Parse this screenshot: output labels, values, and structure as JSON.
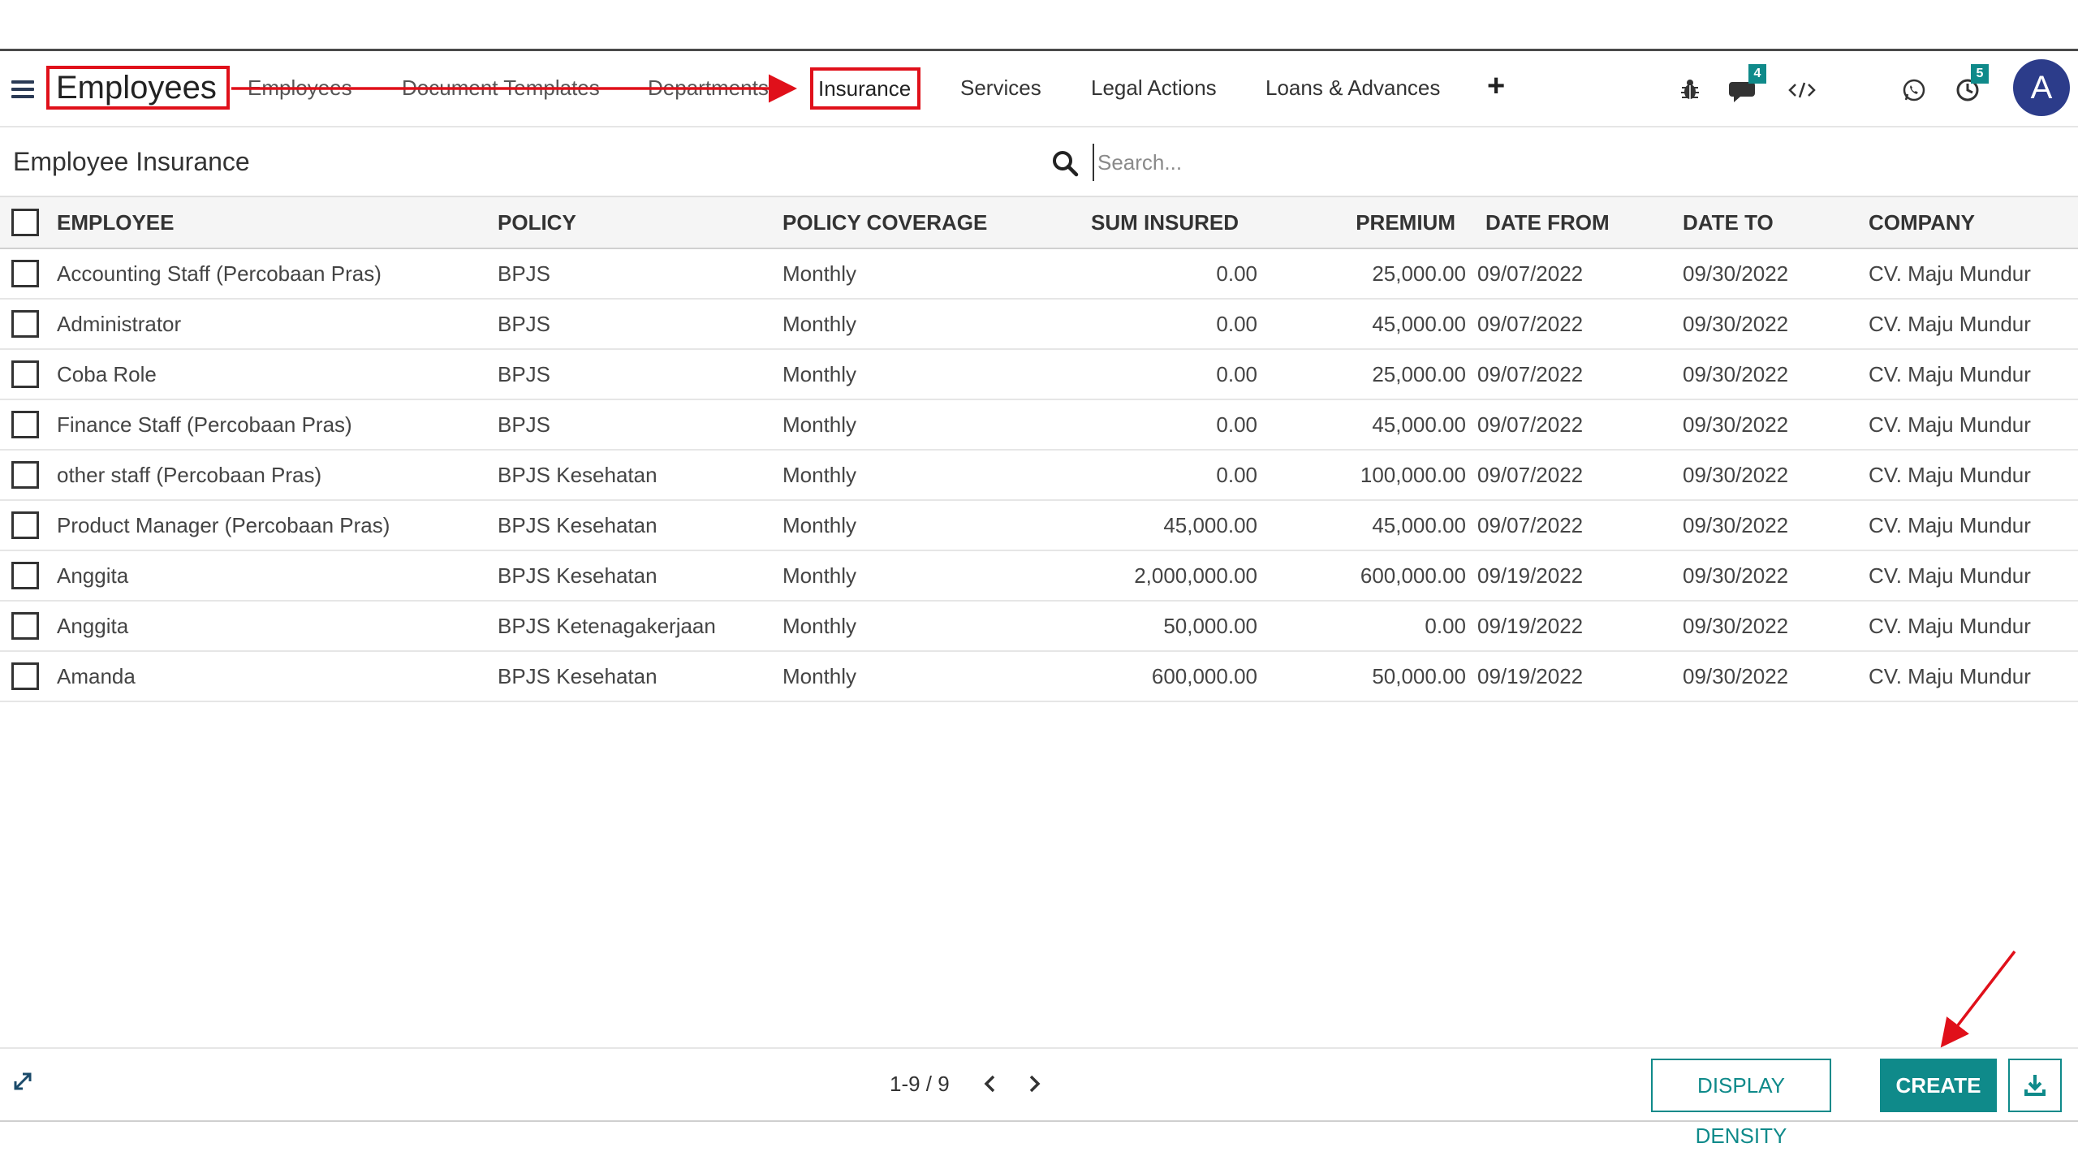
{
  "navbar": {
    "app_title": "Employees",
    "menu": [
      {
        "label": "Employees"
      },
      {
        "label": "Document Templates"
      },
      {
        "label": "Departments"
      },
      {
        "label": "Insurance"
      },
      {
        "label": "Services"
      },
      {
        "label": "Legal Actions"
      },
      {
        "label": "Loans & Advances"
      }
    ],
    "add_label": "+",
    "messages_badge": "4",
    "activities_badge": "5",
    "avatar_letter": "A"
  },
  "controlpanel": {
    "breadcrumb": "Employee Insurance",
    "search_placeholder": "Search..."
  },
  "table": {
    "columns": [
      "EMPLOYEE",
      "POLICY",
      "POLICY COVERAGE",
      "SUM INSURED",
      "PREMIUM",
      "DATE FROM",
      "DATE TO",
      "COMPANY"
    ],
    "rows": [
      {
        "employee": "Accounting Staff (Percobaan Pras)",
        "policy": "BPJS",
        "coverage": "Monthly",
        "sum_insured": "0.00",
        "premium": "25,000.00",
        "date_from": "09/07/2022",
        "date_to": "09/30/2022",
        "company": "CV. Maju Mundur"
      },
      {
        "employee": "Administrator",
        "policy": "BPJS",
        "coverage": "Monthly",
        "sum_insured": "0.00",
        "premium": "45,000.00",
        "date_from": "09/07/2022",
        "date_to": "09/30/2022",
        "company": "CV. Maju Mundur"
      },
      {
        "employee": "Coba Role",
        "policy": "BPJS",
        "coverage": "Monthly",
        "sum_insured": "0.00",
        "premium": "25,000.00",
        "date_from": "09/07/2022",
        "date_to": "09/30/2022",
        "company": "CV. Maju Mundur"
      },
      {
        "employee": "Finance Staff (Percobaan Pras)",
        "policy": "BPJS",
        "coverage": "Monthly",
        "sum_insured": "0.00",
        "premium": "45,000.00",
        "date_from": "09/07/2022",
        "date_to": "09/30/2022",
        "company": "CV. Maju Mundur"
      },
      {
        "employee": "other staff (Percobaan Pras)",
        "policy": "BPJS Kesehatan",
        "coverage": "Monthly",
        "sum_insured": "0.00",
        "premium": "100,000.00",
        "date_from": "09/07/2022",
        "date_to": "09/30/2022",
        "company": "CV. Maju Mundur"
      },
      {
        "employee": "Product Manager (Percobaan Pras)",
        "policy": "BPJS Kesehatan",
        "coverage": "Monthly",
        "sum_insured": "45,000.00",
        "premium": "45,000.00",
        "date_from": "09/07/2022",
        "date_to": "09/30/2022",
        "company": "CV. Maju Mundur"
      },
      {
        "employee": "Anggita",
        "policy": "BPJS Kesehatan",
        "coverage": "Monthly",
        "sum_insured": "2,000,000.00",
        "premium": "600,000.00",
        "date_from": "09/19/2022",
        "date_to": "09/30/2022",
        "company": "CV. Maju Mundur"
      },
      {
        "employee": "Anggita",
        "policy": "BPJS Ketenagakerjaan",
        "coverage": "Monthly",
        "sum_insured": "50,000.00",
        "premium": "0.00",
        "date_from": "09/19/2022",
        "date_to": "09/30/2022",
        "company": "CV. Maju Mundur"
      },
      {
        "employee": "Amanda",
        "policy": "BPJS Kesehatan",
        "coverage": "Monthly",
        "sum_insured": "600,000.00",
        "premium": "50,000.00",
        "date_from": "09/19/2022",
        "date_to": "09/30/2022",
        "company": "CV. Maju Mundur"
      }
    ]
  },
  "footer": {
    "pager_value": "1-9 / 9",
    "display_density_label": "DISPLAY DENSITY",
    "create_label": "CREATE"
  },
  "colors": {
    "accent": "#0f8a8a",
    "annotation_red": "#e0101a",
    "avatar_bg": "#2c3c8a"
  },
  "icons": [
    "hamburger-icon",
    "bug-icon",
    "chat-icon",
    "code-icon",
    "whatsapp-icon",
    "clock-icon",
    "search-icon",
    "expand-icon",
    "chevron-left-icon",
    "chevron-right-icon",
    "download-icon"
  ]
}
